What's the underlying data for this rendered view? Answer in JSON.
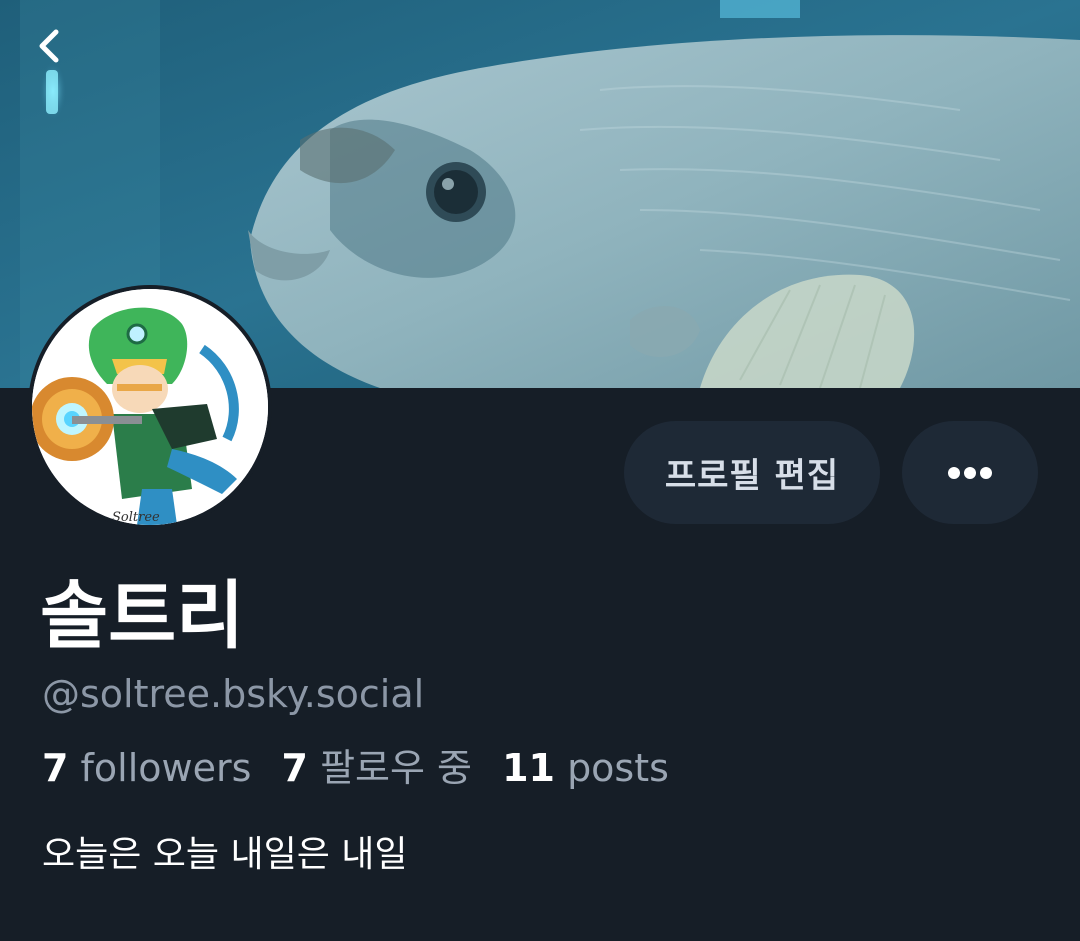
{
  "profile": {
    "display_name": "솔트리",
    "handle": "@soltree.bsky.social",
    "bio": "오늘은 오늘 내일은 내일",
    "avatar_signature": "Soltree"
  },
  "stats": {
    "followers_count": "7",
    "followers_label": "followers",
    "following_count": "7",
    "following_label": "팔로우 중",
    "posts_count": "11",
    "posts_label": "posts"
  },
  "actions": {
    "edit_profile_label": "프로필 편집",
    "more_icon": "ellipsis-icon",
    "back_icon": "chevron-left-icon"
  },
  "colors": {
    "background": "#161e27",
    "button_bg": "#1e2936",
    "handle_text": "#8c97a6"
  }
}
